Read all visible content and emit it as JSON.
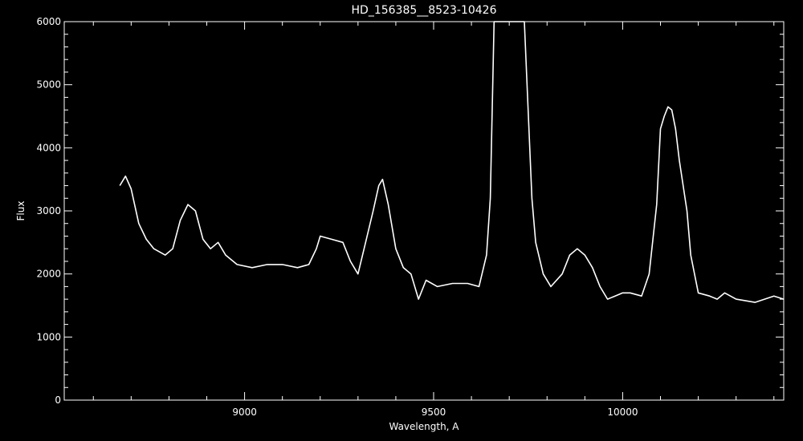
{
  "chart_data": {
    "type": "line",
    "title": "HD_156385__8523-10426",
    "xlabel": "Wavelength, A",
    "ylabel": "Flux",
    "xlim": [
      8523,
      10426
    ],
    "ylim": [
      0,
      6000
    ],
    "x_ticks": [
      9000,
      9500,
      10000
    ],
    "x_tick_labels": [
      "9000",
      "9500",
      "10000"
    ],
    "y_ticks": [
      0,
      1000,
      2000,
      3000,
      4000,
      5000,
      6000
    ],
    "y_tick_labels": [
      "0",
      "1000",
      "2000",
      "3000",
      "4000",
      "5000",
      "6000"
    ],
    "grid": false,
    "colors": {
      "background": "#000000",
      "foreground": "#ffffff"
    },
    "series": [
      {
        "x": [
          8670,
          8685,
          8700,
          8720,
          8740,
          8760,
          8790,
          8810,
          8830,
          8850,
          8870,
          8890,
          8910,
          8930,
          8950,
          8980,
          9020,
          9060,
          9100,
          9140,
          9170,
          9190,
          9200,
          9230,
          9260,
          9280,
          9300,
          9320,
          9340,
          9355,
          9365,
          9380,
          9400,
          9420,
          9440,
          9460,
          9480,
          9510,
          9550,
          9590,
          9620,
          9640,
          9650,
          9660,
          9700,
          9740,
          9760,
          9770,
          9790,
          9810,
          9840,
          9860,
          9880,
          9900,
          9920,
          9940,
          9960,
          9980,
          10000,
          10020,
          10050,
          10070,
          10090,
          10100,
          10110,
          10120,
          10130,
          10140,
          10150,
          10170,
          10180,
          10200,
          10230,
          10250,
          10270,
          10300,
          10350,
          10400,
          10426
        ],
        "y": [
          3400,
          3550,
          3350,
          2800,
          2550,
          2400,
          2300,
          2400,
          2850,
          3100,
          3000,
          2550,
          2400,
          2500,
          2300,
          2150,
          2100,
          2150,
          2150,
          2100,
          2150,
          2400,
          2600,
          2550,
          2500,
          2200,
          2000,
          2500,
          3000,
          3400,
          3500,
          3100,
          2400,
          2100,
          2000,
          1600,
          1900,
          1800,
          1850,
          1850,
          1800,
          2300,
          3200,
          6000,
          6000,
          6000,
          3200,
          2500,
          2000,
          1800,
          2000,
          2300,
          2400,
          2300,
          2100,
          1800,
          1600,
          1650,
          1700,
          1700,
          1650,
          2000,
          3100,
          4300,
          4500,
          4650,
          4600,
          4300,
          3800,
          3000,
          2300,
          1700,
          1650,
          1600,
          1700,
          1600,
          1550,
          1650,
          1600
        ]
      }
    ]
  }
}
